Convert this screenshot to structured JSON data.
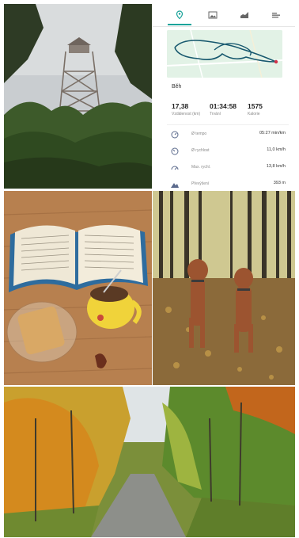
{
  "app": {
    "activity_label": "Běh",
    "stats": [
      {
        "value": "17,38",
        "label": "Vzdálenost (km)"
      },
      {
        "value": "01:34:58",
        "label": "Trvání"
      },
      {
        "value": "1575",
        "label": "Kalorie"
      }
    ],
    "rows": [
      {
        "icon": "tempo-icon",
        "label": "Ø tempo",
        "value": "05:27 min/km"
      },
      {
        "icon": "speed-icon",
        "label": "Ø rychlost",
        "value": "11,0 km/h"
      },
      {
        "icon": "max-speed-icon",
        "label": "Max. rychl.",
        "value": "13,8 km/h"
      },
      {
        "icon": "elevation-icon",
        "label": "Převýšení",
        "value": "393 m"
      }
    ],
    "accent_color": "#1aa39a"
  }
}
